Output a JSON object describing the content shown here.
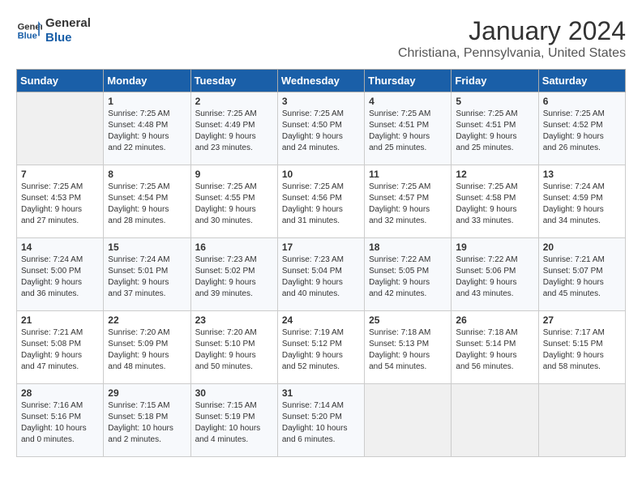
{
  "header": {
    "logo_line1": "General",
    "logo_line2": "Blue",
    "month": "January 2024",
    "location": "Christiana, Pennsylvania, United States"
  },
  "days_of_week": [
    "Sunday",
    "Monday",
    "Tuesday",
    "Wednesday",
    "Thursday",
    "Friday",
    "Saturday"
  ],
  "weeks": [
    [
      {
        "day": "",
        "content": ""
      },
      {
        "day": "1",
        "content": "Sunrise: 7:25 AM\nSunset: 4:48 PM\nDaylight: 9 hours\nand 22 minutes."
      },
      {
        "day": "2",
        "content": "Sunrise: 7:25 AM\nSunset: 4:49 PM\nDaylight: 9 hours\nand 23 minutes."
      },
      {
        "day": "3",
        "content": "Sunrise: 7:25 AM\nSunset: 4:50 PM\nDaylight: 9 hours\nand 24 minutes."
      },
      {
        "day": "4",
        "content": "Sunrise: 7:25 AM\nSunset: 4:51 PM\nDaylight: 9 hours\nand 25 minutes."
      },
      {
        "day": "5",
        "content": "Sunrise: 7:25 AM\nSunset: 4:51 PM\nDaylight: 9 hours\nand 25 minutes."
      },
      {
        "day": "6",
        "content": "Sunrise: 7:25 AM\nSunset: 4:52 PM\nDaylight: 9 hours\nand 26 minutes."
      }
    ],
    [
      {
        "day": "7",
        "content": "Sunrise: 7:25 AM\nSunset: 4:53 PM\nDaylight: 9 hours\nand 27 minutes."
      },
      {
        "day": "8",
        "content": "Sunrise: 7:25 AM\nSunset: 4:54 PM\nDaylight: 9 hours\nand 28 minutes."
      },
      {
        "day": "9",
        "content": "Sunrise: 7:25 AM\nSunset: 4:55 PM\nDaylight: 9 hours\nand 30 minutes."
      },
      {
        "day": "10",
        "content": "Sunrise: 7:25 AM\nSunset: 4:56 PM\nDaylight: 9 hours\nand 31 minutes."
      },
      {
        "day": "11",
        "content": "Sunrise: 7:25 AM\nSunset: 4:57 PM\nDaylight: 9 hours\nand 32 minutes."
      },
      {
        "day": "12",
        "content": "Sunrise: 7:25 AM\nSunset: 4:58 PM\nDaylight: 9 hours\nand 33 minutes."
      },
      {
        "day": "13",
        "content": "Sunrise: 7:24 AM\nSunset: 4:59 PM\nDaylight: 9 hours\nand 34 minutes."
      }
    ],
    [
      {
        "day": "14",
        "content": "Sunrise: 7:24 AM\nSunset: 5:00 PM\nDaylight: 9 hours\nand 36 minutes."
      },
      {
        "day": "15",
        "content": "Sunrise: 7:24 AM\nSunset: 5:01 PM\nDaylight: 9 hours\nand 37 minutes."
      },
      {
        "day": "16",
        "content": "Sunrise: 7:23 AM\nSunset: 5:02 PM\nDaylight: 9 hours\nand 39 minutes."
      },
      {
        "day": "17",
        "content": "Sunrise: 7:23 AM\nSunset: 5:04 PM\nDaylight: 9 hours\nand 40 minutes."
      },
      {
        "day": "18",
        "content": "Sunrise: 7:22 AM\nSunset: 5:05 PM\nDaylight: 9 hours\nand 42 minutes."
      },
      {
        "day": "19",
        "content": "Sunrise: 7:22 AM\nSunset: 5:06 PM\nDaylight: 9 hours\nand 43 minutes."
      },
      {
        "day": "20",
        "content": "Sunrise: 7:21 AM\nSunset: 5:07 PM\nDaylight: 9 hours\nand 45 minutes."
      }
    ],
    [
      {
        "day": "21",
        "content": "Sunrise: 7:21 AM\nSunset: 5:08 PM\nDaylight: 9 hours\nand 47 minutes."
      },
      {
        "day": "22",
        "content": "Sunrise: 7:20 AM\nSunset: 5:09 PM\nDaylight: 9 hours\nand 48 minutes."
      },
      {
        "day": "23",
        "content": "Sunrise: 7:20 AM\nSunset: 5:10 PM\nDaylight: 9 hours\nand 50 minutes."
      },
      {
        "day": "24",
        "content": "Sunrise: 7:19 AM\nSunset: 5:12 PM\nDaylight: 9 hours\nand 52 minutes."
      },
      {
        "day": "25",
        "content": "Sunrise: 7:18 AM\nSunset: 5:13 PM\nDaylight: 9 hours\nand 54 minutes."
      },
      {
        "day": "26",
        "content": "Sunrise: 7:18 AM\nSunset: 5:14 PM\nDaylight: 9 hours\nand 56 minutes."
      },
      {
        "day": "27",
        "content": "Sunrise: 7:17 AM\nSunset: 5:15 PM\nDaylight: 9 hours\nand 58 minutes."
      }
    ],
    [
      {
        "day": "28",
        "content": "Sunrise: 7:16 AM\nSunset: 5:16 PM\nDaylight: 10 hours\nand 0 minutes."
      },
      {
        "day": "29",
        "content": "Sunrise: 7:15 AM\nSunset: 5:18 PM\nDaylight: 10 hours\nand 2 minutes."
      },
      {
        "day": "30",
        "content": "Sunrise: 7:15 AM\nSunset: 5:19 PM\nDaylight: 10 hours\nand 4 minutes."
      },
      {
        "day": "31",
        "content": "Sunrise: 7:14 AM\nSunset: 5:20 PM\nDaylight: 10 hours\nand 6 minutes."
      },
      {
        "day": "",
        "content": ""
      },
      {
        "day": "",
        "content": ""
      },
      {
        "day": "",
        "content": ""
      }
    ]
  ]
}
